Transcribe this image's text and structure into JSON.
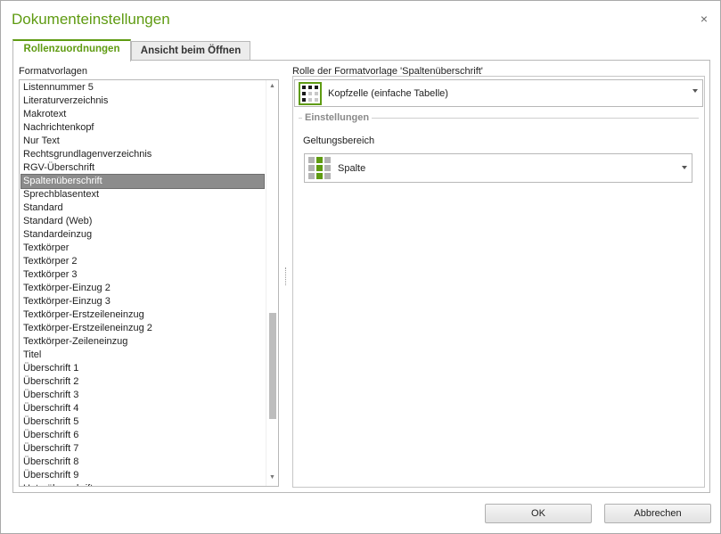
{
  "dialog": {
    "title": "Dokumenteinstellungen",
    "close_glyph": "×"
  },
  "tabs": [
    {
      "label": "Rollenzuordnungen",
      "active": true
    },
    {
      "label": "Ansicht beim Öffnen",
      "active": false
    }
  ],
  "left": {
    "label": "Formatvorlagen",
    "selected_index": 7,
    "items": [
      "Listennummer 5",
      "Literaturverzeichnis",
      "Makrotext",
      "Nachrichtenkopf",
      "Nur Text",
      "Rechtsgrundlagenverzeichnis",
      "RGV-Überschrift",
      "Spaltenüberschrift",
      "Sprechblasentext",
      "Standard",
      "Standard (Web)",
      "Standardeinzug",
      "Textkörper",
      "Textkörper 2",
      "Textkörper 3",
      "Textkörper-Einzug 2",
      "Textkörper-Einzug 3",
      "Textkörper-Erstzeileneinzug",
      "Textkörper-Erstzeileneinzug 2",
      "Textkörper-Zeileneinzug",
      "Titel",
      "Überschrift 1",
      "Überschrift 2",
      "Überschrift 3",
      "Überschrift 4",
      "Überschrift 5",
      "Überschrift 6",
      "Überschrift 7",
      "Überschrift 8",
      "Überschrift 9",
      "Unterüberschrift"
    ]
  },
  "right": {
    "role_label": "Rolle der Formatvorlage 'Spaltenüberschrift'",
    "role_value": "Kopfzelle (einfache Tabelle)",
    "role_icon": "table-header-icon",
    "group_title": "Einstellungen",
    "scope_label": "Geltungsbereich",
    "scope_value": "Spalte",
    "scope_icon": "column-scope-icon"
  },
  "colors": {
    "accent": "#5f9b12",
    "selection": "#8c8c8c"
  },
  "buttons": {
    "ok": "OK",
    "cancel": "Abbrechen"
  }
}
